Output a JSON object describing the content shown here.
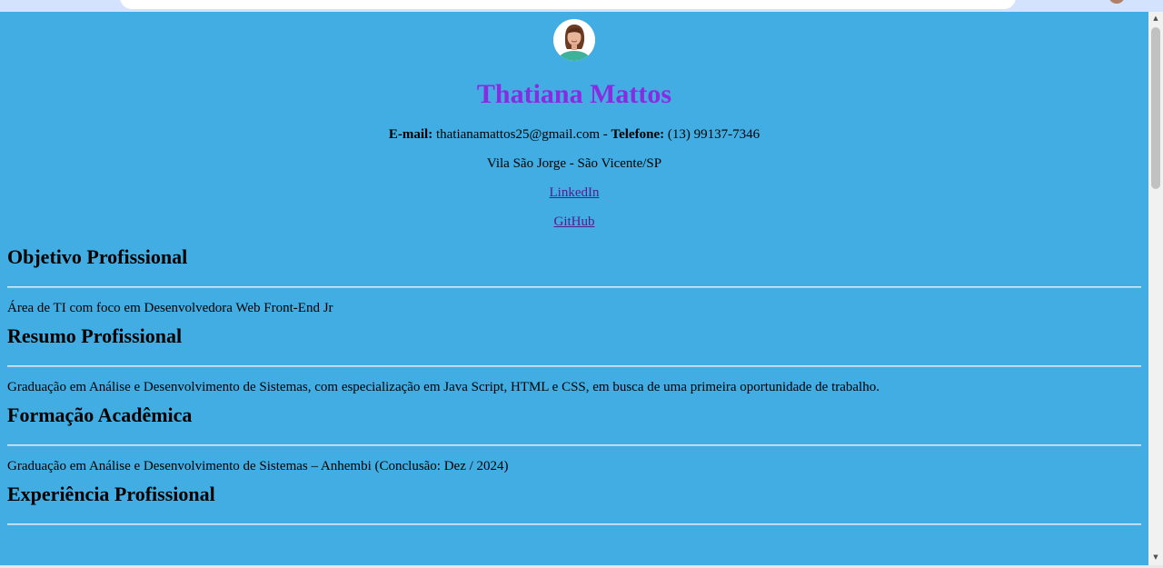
{
  "profile": {
    "name": "Thatiana Mattos",
    "email_label": "E-mail:",
    "email": "thatianamattos25@gmail.com",
    "separator": " - ",
    "phone_label": "Telefone:",
    "phone": "(13) 99137-7346",
    "address": "Vila São Jorge - São Vicente/SP",
    "links": {
      "linkedin": "LinkedIn",
      "github": "GitHub"
    }
  },
  "sections": [
    {
      "title": "Objetivo Profissional",
      "text": "Área de TI com foco em Desenvolvedora Web Front-End Jr"
    },
    {
      "title": "Resumo Profissional",
      "text": "Graduação em Análise e Desenvolvimento de Sistemas, com especialização em Java Script, HTML e CSS, em busca de uma primeira oportunidade de trabalho."
    },
    {
      "title": "Formação Acadêmica",
      "text": "Graduação em Análise e Desenvolvimento de Sistemas – Anhembi (Conclusão: Dez / 2024)"
    },
    {
      "title": "Experiência Profissional",
      "text": ""
    }
  ],
  "colors": {
    "page_background": "#42ade2",
    "name_color": "#8a2be2",
    "link_color": "#551a8b"
  },
  "icons": {
    "scroll_up": "▲",
    "scroll_down": "▼"
  }
}
